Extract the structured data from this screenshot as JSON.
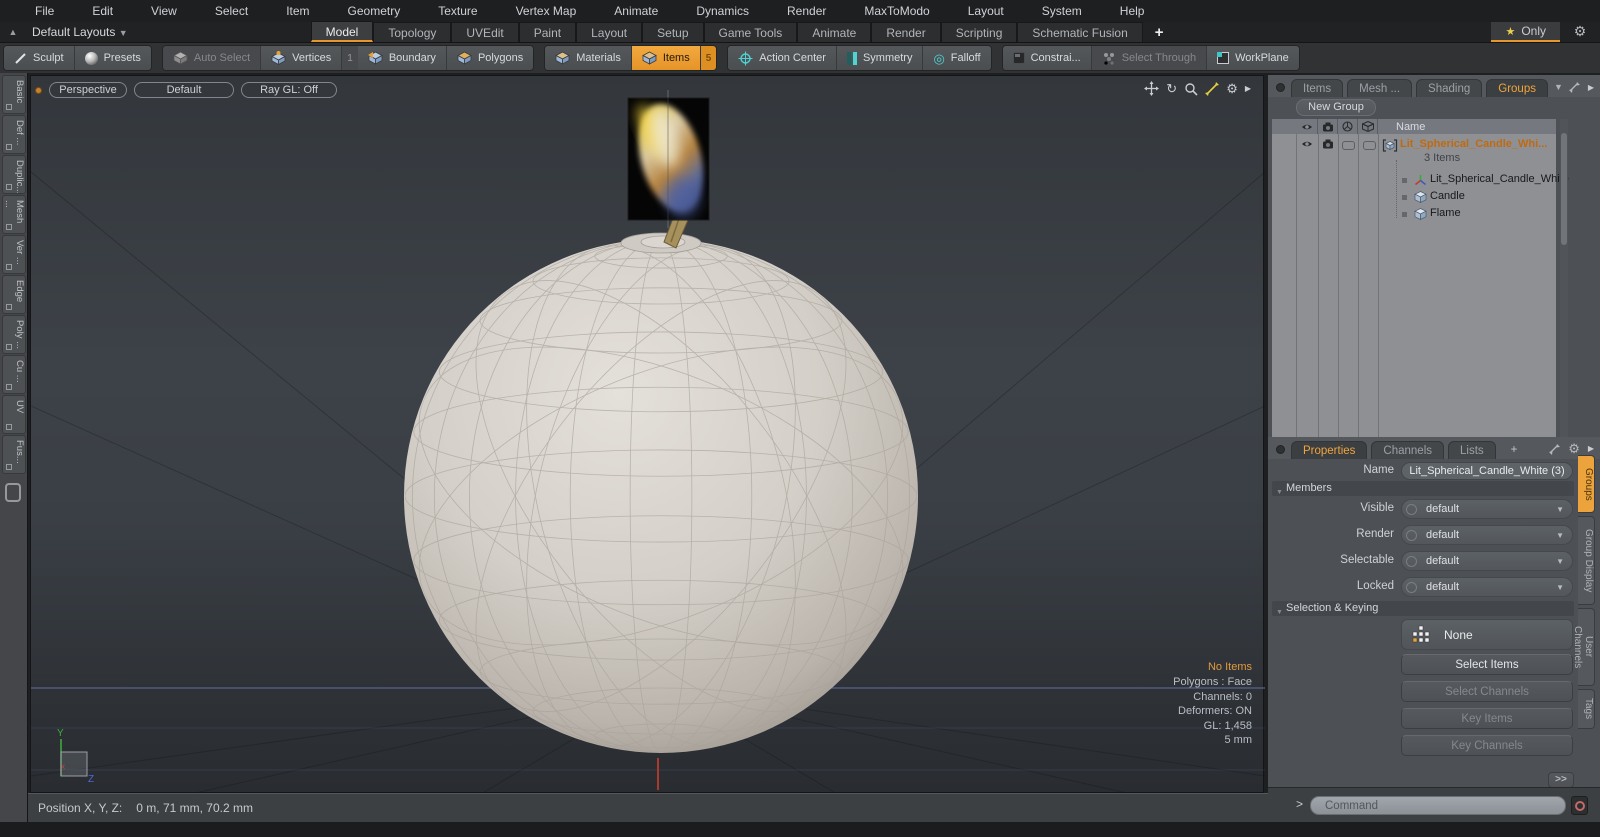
{
  "menu_bar": {
    "items": [
      "File",
      "Edit",
      "View",
      "Select",
      "Item",
      "Geometry",
      "Texture",
      "Vertex Map",
      "Animate",
      "Dynamics",
      "Render",
      "MaxToModo",
      "Layout",
      "System",
      "Help"
    ]
  },
  "layout_bar": {
    "default_layouts": "Default Layouts",
    "tabs": [
      "Model",
      "Topology",
      "UVEdit",
      "Paint",
      "Layout",
      "Setup",
      "Game Tools",
      "Animate",
      "Render",
      "Scripting",
      "Schematic Fusion"
    ],
    "active_tab": "Model",
    "add_tab": "+",
    "only_star": "★",
    "only_label": "Only"
  },
  "toolbar": {
    "sculpt": "Sculpt",
    "presets": "Presets",
    "auto_select": "Auto Select",
    "vertices": "Vertices",
    "vertices_badge": "1",
    "boundary": "Boundary",
    "polygons": "Polygons",
    "materials": "Materials",
    "items": "Items",
    "items_badge": "5",
    "action_center": "Action Center",
    "symmetry": "Symmetry",
    "falloff": "Falloff",
    "constraints": "Constrai...",
    "select_through": "Select Through",
    "workplane": "WorkPlane"
  },
  "left_tabs": [
    "Basic",
    "Def ...",
    "Duplic...",
    "Mesh ...",
    "Ver ...",
    "Edge",
    "Poly ...",
    "Cu ...",
    "UV",
    "Fus..."
  ],
  "viewport": {
    "camera": "Perspective",
    "style": "Default",
    "raygl": "Ray GL: Off",
    "status": {
      "no_items": "No Items",
      "polygons": "Polygons : Face",
      "channels": "Channels: 0",
      "deformers": "Deformers: ON",
      "gl": "GL: 1,458",
      "scale": "5 mm"
    },
    "axis": {
      "y": "Y",
      "z": "Z"
    }
  },
  "item_list_panel": {
    "tabs": [
      "Items",
      "Mesh ...",
      "Shading",
      "Groups"
    ],
    "active_tab": "Groups",
    "new_group": "New Group",
    "name_header": "Name",
    "group": {
      "name": "Lit_Spherical_Candle_Whi...",
      "count": "3 Items",
      "children": [
        "Lit_Spherical_Candle_White",
        "Candle",
        "Flame"
      ]
    }
  },
  "properties_panel": {
    "tabs": [
      "Properties",
      "Channels",
      "Lists",
      "+"
    ],
    "active_tab": "Properties",
    "name_label": "Name",
    "name_value": "Lit_Spherical_Candle_White (3)",
    "members_header": "Members",
    "rows": [
      {
        "label": "Visible",
        "value": "default"
      },
      {
        "label": "Render",
        "value": "default"
      },
      {
        "label": "Selectable",
        "value": "default"
      },
      {
        "label": "Locked",
        "value": "default"
      }
    ],
    "selection_header": "Selection & Keying",
    "none_button": "None",
    "buttons": [
      {
        "label": "Select Items",
        "enabled": true
      },
      {
        "label": "Select Channels",
        "enabled": false
      },
      {
        "label": "Key Items",
        "enabled": false
      },
      {
        "label": "Key Channels",
        "enabled": false
      }
    ],
    "more_button": ">>",
    "side_tabs": [
      "Groups",
      "Group Display",
      "User Channels",
      "Tags"
    ],
    "active_side_tab": "Groups"
  },
  "command_bar": {
    "prompt": ">",
    "placeholder": "Command"
  },
  "status_bar": {
    "label": "Position X, Y, Z:",
    "value": "0 m, 71 mm, 70.2 mm"
  },
  "colors": {
    "accent": "#e8962e",
    "selection_orange": "#e8a33d",
    "horizon_blue": "#56648c"
  }
}
